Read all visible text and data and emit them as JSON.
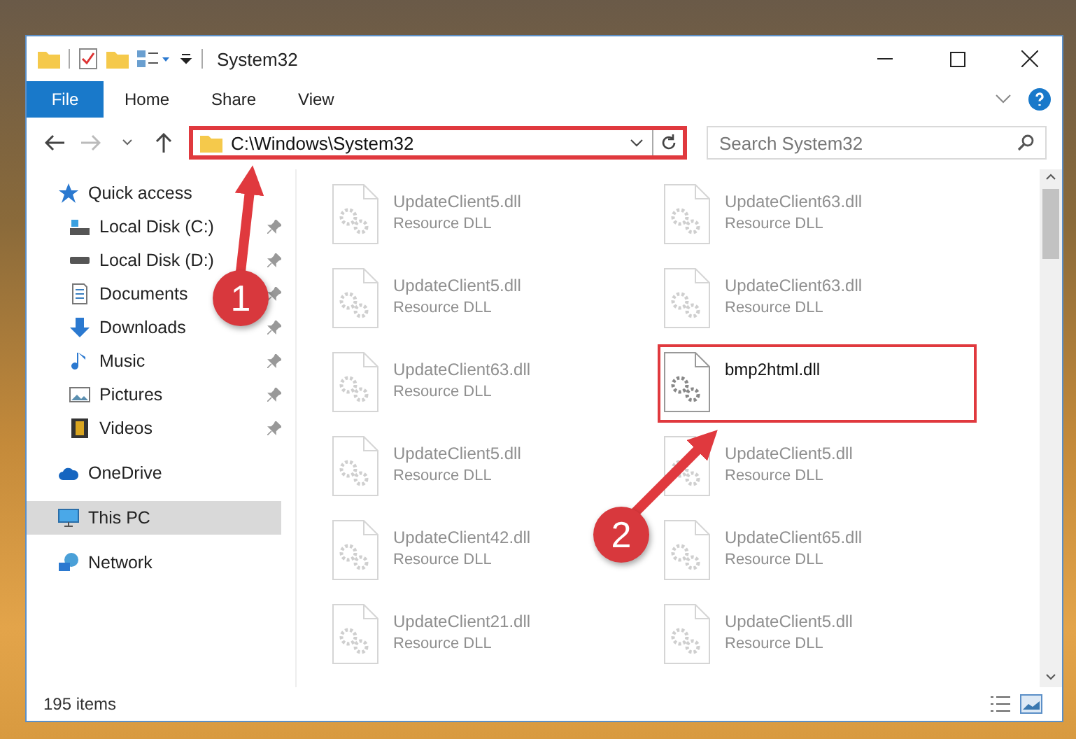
{
  "window": {
    "title": "System32"
  },
  "ribbon_tabs": [
    {
      "label": "File",
      "kind": "menu"
    },
    {
      "label": "Home",
      "kind": "tab"
    },
    {
      "label": "Share",
      "kind": "tab"
    },
    {
      "label": "View",
      "kind": "tab"
    }
  ],
  "address_bar": {
    "path": "C:\\Windows\\System32",
    "highlighted": true
  },
  "search": {
    "placeholder": "Search System32"
  },
  "sidebar": {
    "items": [
      {
        "label": "Quick access",
        "kind": "star",
        "selected": false,
        "children": [
          {
            "label": "Local Disk (C:)",
            "kind": "system-drive",
            "pinned": true,
            "selected": false
          },
          {
            "label": "Local Disk (D:)",
            "kind": "drive",
            "pinned": true,
            "selected": false
          },
          {
            "label": "Documents",
            "kind": "documents",
            "pinned": true,
            "selected": false
          },
          {
            "label": "Downloads",
            "kind": "downloads",
            "pinned": true,
            "selected": false
          },
          {
            "label": "Music",
            "kind": "music",
            "pinned": true,
            "selected": false
          },
          {
            "label": "Pictures",
            "kind": "pictures",
            "pinned": true,
            "selected": false
          },
          {
            "label": "Videos",
            "kind": "videos",
            "pinned": true,
            "selected": false
          }
        ]
      },
      {
        "label": "OneDrive",
        "kind": "cloud",
        "selected": false
      },
      {
        "label": "This PC",
        "kind": "computer",
        "selected": true
      },
      {
        "label": "Network",
        "kind": "network",
        "selected": false
      }
    ]
  },
  "files": [
    {
      "name": "UpdateClient5.dll",
      "type": "Resource DLL",
      "blurred": true,
      "highlighted": false
    },
    {
      "name": "UpdateClient63.dll",
      "type": "Resource DLL",
      "blurred": true,
      "highlighted": false
    },
    {
      "name": "UpdateClient5.dll",
      "type": "Resource DLL",
      "blurred": true,
      "highlighted": false
    },
    {
      "name": "UpdateClient63.dll",
      "type": "Resource DLL",
      "blurred": true,
      "highlighted": false
    },
    {
      "name": "UpdateClient63.dll",
      "type": "Resource DLL",
      "blurred": true,
      "highlighted": false
    },
    {
      "name": "bmp2html.dll",
      "blurred": false,
      "highlighted": true
    },
    {
      "name": "UpdateClient5.dll",
      "type": "Resource DLL",
      "blurred": true,
      "highlighted": false
    },
    {
      "name": "UpdateClient5.dll",
      "type": "Resource DLL",
      "blurred": true,
      "highlighted": false
    },
    {
      "name": "UpdateClient42.dll",
      "type": "Resource DLL",
      "blurred": true,
      "highlighted": false
    },
    {
      "name": "UpdateClient65.dll",
      "type": "Resource DLL",
      "blurred": true,
      "highlighted": false
    },
    {
      "name": "UpdateClient21.dll",
      "type": "Resource DLL",
      "blurred": true,
      "highlighted": false
    },
    {
      "name": "UpdateClient5.dll",
      "type": "Resource DLL",
      "blurred": true,
      "highlighted": false
    }
  ],
  "status_bar": {
    "item_count": "195 items"
  },
  "annotations": [
    {
      "label": "1"
    },
    {
      "label": "2"
    }
  ]
}
